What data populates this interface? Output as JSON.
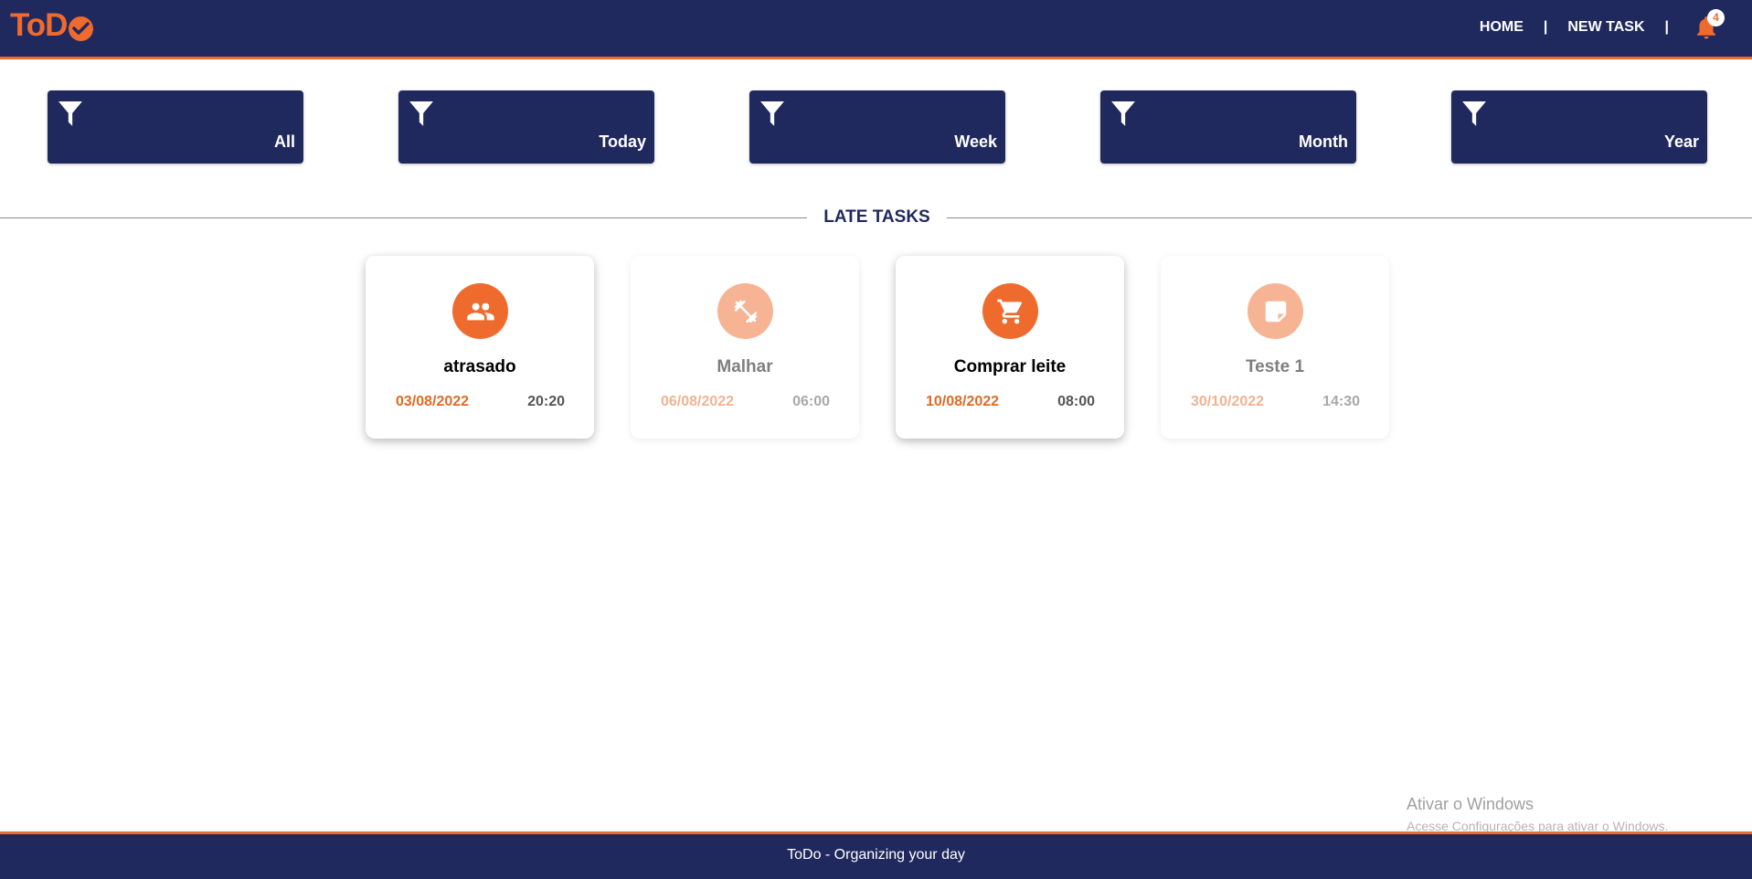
{
  "header": {
    "logo_text": "ToD",
    "nav": {
      "home": "HOME",
      "separator": "|",
      "new_task": "NEW TASK"
    },
    "notifications": {
      "count": "4",
      "icon": "bell-icon"
    }
  },
  "filters": [
    {
      "label": "All",
      "icon": "filter-icon"
    },
    {
      "label": "Today",
      "icon": "filter-icon"
    },
    {
      "label": "Week",
      "icon": "filter-icon"
    },
    {
      "label": "Month",
      "icon": "filter-icon"
    },
    {
      "label": "Year",
      "icon": "filter-icon"
    }
  ],
  "section": {
    "title": "LATE TASKS"
  },
  "tasks": [
    {
      "title": "atrasado",
      "date": "03/08/2022",
      "time": "20:20",
      "icon": "people-icon",
      "faded": false
    },
    {
      "title": "Malhar",
      "date": "06/08/2022",
      "time": "06:00",
      "icon": "dumbbell-icon",
      "faded": true
    },
    {
      "title": "Comprar leite",
      "date": "10/08/2022",
      "time": "08:00",
      "icon": "cart-icon",
      "faded": false
    },
    {
      "title": "Teste 1",
      "date": "30/10/2022",
      "time": "14:30",
      "icon": "note-icon",
      "faded": true
    }
  ],
  "watermark": {
    "line1": "Ativar o Windows",
    "line2": "Acesse Configurações para ativar o Windows."
  },
  "footer": {
    "text": "ToDo - Organizing your day"
  },
  "colors": {
    "navy": "#20295e",
    "orange": "#ee6b2d"
  }
}
